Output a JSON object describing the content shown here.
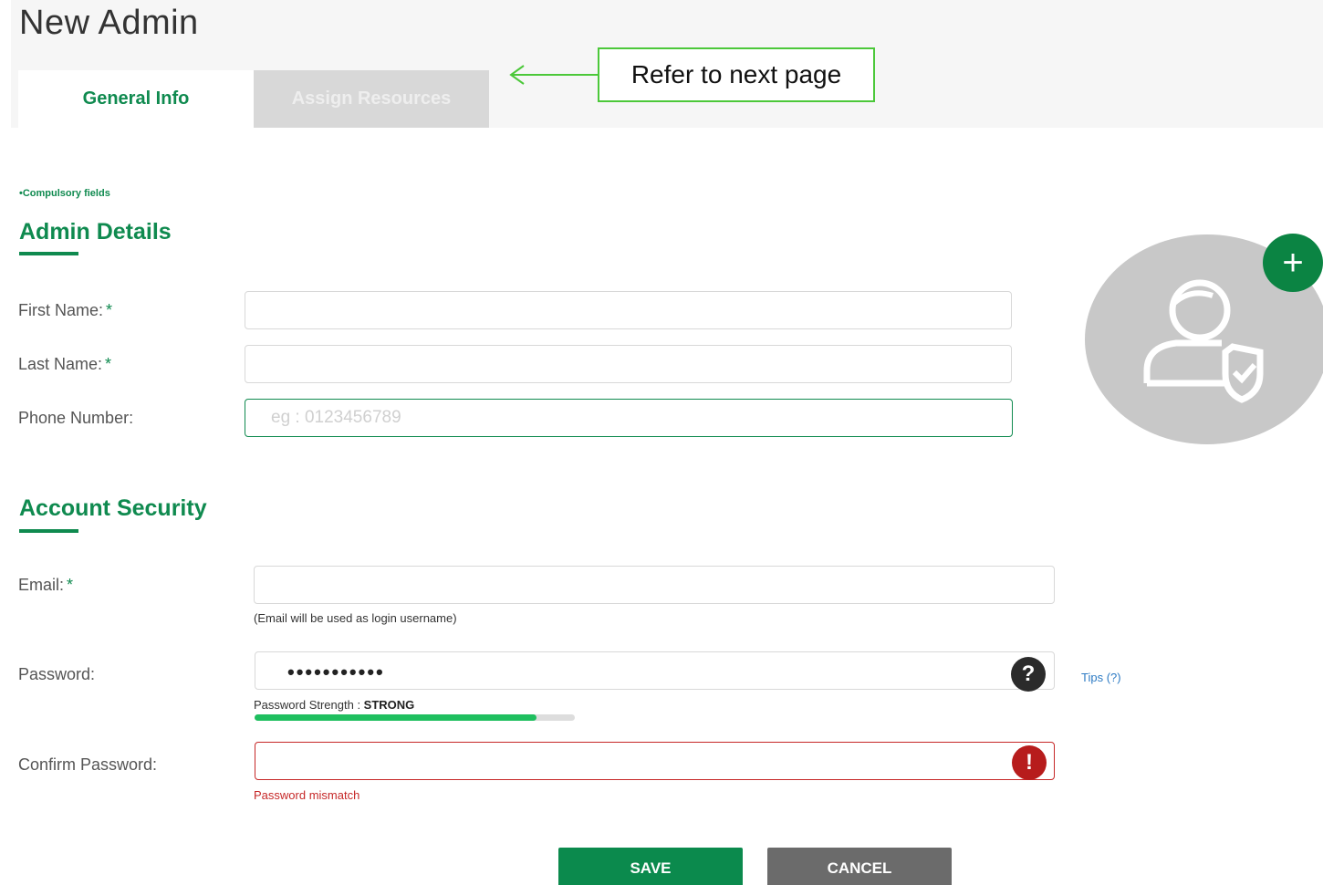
{
  "page": {
    "title": "New Admin"
  },
  "tabs": [
    {
      "label": "General Info",
      "active": true
    },
    {
      "label": "Assign Resources",
      "active": false
    }
  ],
  "annotation": {
    "text": "Refer to next page"
  },
  "compulsory_note": "•Compulsory fields",
  "admin_details": {
    "title": "Admin Details",
    "first_name": {
      "label": "First Name:",
      "required": "*",
      "value": ""
    },
    "last_name": {
      "label": "Last Name:",
      "required": "*",
      "value": ""
    },
    "phone": {
      "label": "Phone Number:",
      "placeholder": "eg : 0123456789",
      "value": ""
    }
  },
  "account_security": {
    "title": "Account Security",
    "email": {
      "label": "Email:",
      "required": "*",
      "value": "",
      "hint": "(Email will be used as login username)"
    },
    "password": {
      "label": "Password:",
      "value_masked": "•••••••••••",
      "help_icon": "?",
      "tips_label": "Tips (?)",
      "strength_prefix": "Password Strength : ",
      "strength_value": "STRONG",
      "strength_fraction": 0.88
    },
    "confirm_password": {
      "label": "Confirm Password:",
      "value": "",
      "error_icon": "!",
      "error_text": "Password mismatch"
    }
  },
  "avatar": {
    "icon": "admin-user-shield-icon",
    "add_icon_glyph": "+"
  },
  "buttons": {
    "save_label": "SAVE",
    "cancel_label": "CANCEL"
  },
  "colors": {
    "brand_green": "#0f8a4f",
    "error_red": "#c62828",
    "strength_green": "#1fbf5f",
    "annotation_green": "#4cc83a"
  }
}
